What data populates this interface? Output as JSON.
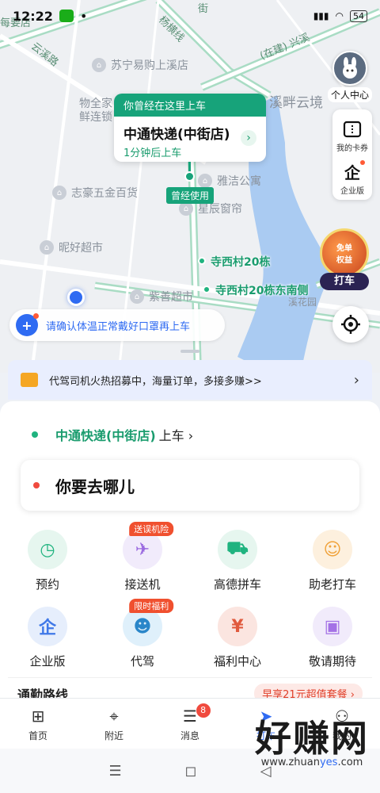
{
  "status_bar": {
    "time": "12:22",
    "signal": "•",
    "battery": "54"
  },
  "map": {
    "pois": [
      {
        "label": "苏宁易购上溪店"
      },
      {
        "label": "志豪五金百货"
      },
      {
        "label": "雅洁公寓"
      },
      {
        "label": "星辰窗帘"
      },
      {
        "label": "昵好超市"
      },
      {
        "label": "紫善超市"
      }
    ],
    "texts": {
      "area1": "溪畔云境",
      "area2": "物全家",
      "area3": "鲜连锁",
      "road1": "杨横线",
      "road2": "(在建) 兴溪",
      "road3": "云溪路",
      "road4": "每要店",
      "road5": "街",
      "road6": "溪花园"
    },
    "stops": [
      {
        "label": "寺西村20栋"
      },
      {
        "label": "寺西村20栋东南侧"
      }
    ]
  },
  "pickup_card": {
    "header": "你曾经在这里上车",
    "name": "中通快递(中街店)",
    "sub": "1分钟后上车",
    "go": "›",
    "used_tag": "曾经使用"
  },
  "profile": {
    "label": "个人中心"
  },
  "side_panel": [
    {
      "label": "我的卡券",
      "icon": "coupon-icon"
    },
    {
      "label": "企业版",
      "icon": "enterprise-icon",
      "glyph": "企"
    }
  ],
  "promo": {
    "line1": "免单",
    "line2": "权益",
    "button": "打车"
  },
  "notice": {
    "glyph": "+",
    "text": "请确认体温正常戴好口罩再上车"
  },
  "recruit": {
    "text": "代驾司机火热招募中，海量订单，多接多赚>>",
    "arrow": "›"
  },
  "trip": {
    "from_place": "中通快递(中街店)",
    "from_suffix": "上车 ›",
    "destination": "你要去哪儿"
  },
  "services": [
    {
      "label": "预约",
      "glyph": "◷",
      "bg": "#e6f6ef",
      "fg": "#1fb37f",
      "tag": ""
    },
    {
      "label": "接送机",
      "glyph": "✈",
      "bg": "#f1ebfb",
      "fg": "#9b6be0",
      "tag": "送误机险"
    },
    {
      "label": "高德拼车",
      "glyph": "⛟",
      "bg": "#e6f6ef",
      "fg": "#1fb37f",
      "tag": ""
    },
    {
      "label": "助老打车",
      "glyph": "☺",
      "bg": "#fdf0de",
      "fg": "#f0a23a",
      "tag": ""
    },
    {
      "label": "企业版",
      "glyph": "企",
      "bg": "#e6eefc",
      "fg": "#3f78e8",
      "tag": ""
    },
    {
      "label": "代驾",
      "glyph": "☻",
      "bg": "#dff0fb",
      "fg": "#2a86c9",
      "tag": "限时福利"
    },
    {
      "label": "福利中心",
      "glyph": "¥",
      "bg": "#fbe5e0",
      "fg": "#e05a3e",
      "tag": ""
    },
    {
      "label": "敬请期待",
      "glyph": "▣",
      "bg": "#f1ebfb",
      "fg": "#a472e6",
      "tag": ""
    }
  ],
  "commute": {
    "title": "通勤路线",
    "ad": "早享21元超值套餐 ›"
  },
  "tabs": [
    {
      "label": "首页",
      "glyph": "⊞",
      "badge": ""
    },
    {
      "label": "附近",
      "glyph": "⌖",
      "badge": ""
    },
    {
      "label": "消息",
      "glyph": "☰",
      "badge": "8"
    },
    {
      "label": "打车",
      "glyph": "➤",
      "badge": ""
    },
    {
      "label": "我的",
      "glyph": "⚇",
      "badge": ""
    }
  ],
  "nav_buttons": {
    "menu": "☰",
    "home": "◻",
    "back": "◁"
  },
  "watermark": {
    "big": "好赚网",
    "small_pre": "www.zhuan",
    "small_mid": "yes",
    "small_post": ".com"
  }
}
